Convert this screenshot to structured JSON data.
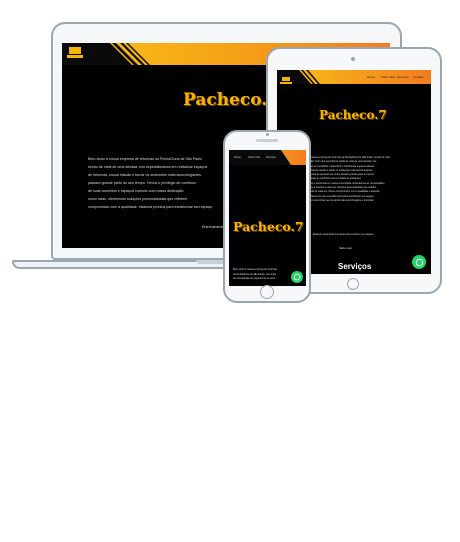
{
  "site": {
    "brand": "Pacheco.7",
    "logo_text": "PACHECO.7",
    "nav": [
      "Home",
      "Sobre Nós",
      "Serviços",
      "Contato"
    ]
  },
  "laptop": {
    "lines": [
      "Bem-vindo à nossa empresa de reformas na Penha/Zona de São Paulo",
      "sendo de mais de uma década, nos especializamos em revitalizar espaços",
      "de reformas, nossa missão é tornar os ambientes mais aconchegantes",
      "passam grande parte do seu tempo. Temos o privilégio de contribuir",
      "de suas conceitos e espaços comuns com nossa dedicação",
      "como raras, oferecendo soluções personalizadas que refletem",
      "compromisso com a qualidade, estamos prontos para transformar seu espaço"
    ],
    "footer": "Entrenamento"
  },
  "tablet": {
    "lines": [
      "Bem-vindo à nossa empresa de reformas na Penha/Zona de São Paulo, sendo há mais",
      "de uma década. Com uma experiência sólida de mais de uma década, nos",
      "especializamos em revitalizar, modernizar e transformar espaços através",
      "de reformas. Nossa missão é tornar os ambientes mais aconchegantes",
      "e agradáveis para as pessoas que neles passam grande parte do tempo.",
      "Temos o privilégio de contribuir para a criação de ambientes",
      "aconchegantes e funcionais em nossa comunidade. Entendemos as necessidades",
      "de cada cliente e buscamos oferecer soluções personalizadas que reflitam",
      "a personalidade de cada um. Nosso compromisso com a qualidade e atenção",
      "aos detalhes fazem de nós a escolha certa para transformar seu espaço.",
      "Conte conosco para tornar seu lar ainda mais aconchegante e funcional."
    ],
    "extra1": "Estamos esperando sua visita para conhecer seu projeto",
    "extra2": "Saiba mais",
    "section": "Serviços"
  },
  "phone": {
    "lines": [
      "Bem-vindo à nossa empresa de reformas",
      "na Penha/Zona de São Paulo, com mais",
      "de uma década de experiência no ramo"
    ]
  },
  "colors": {
    "gold": "#f6b400",
    "whatsapp": "#25d366",
    "device_frame": "#9aa6b0"
  },
  "icons": {
    "whatsapp": "whatsapp-icon"
  }
}
